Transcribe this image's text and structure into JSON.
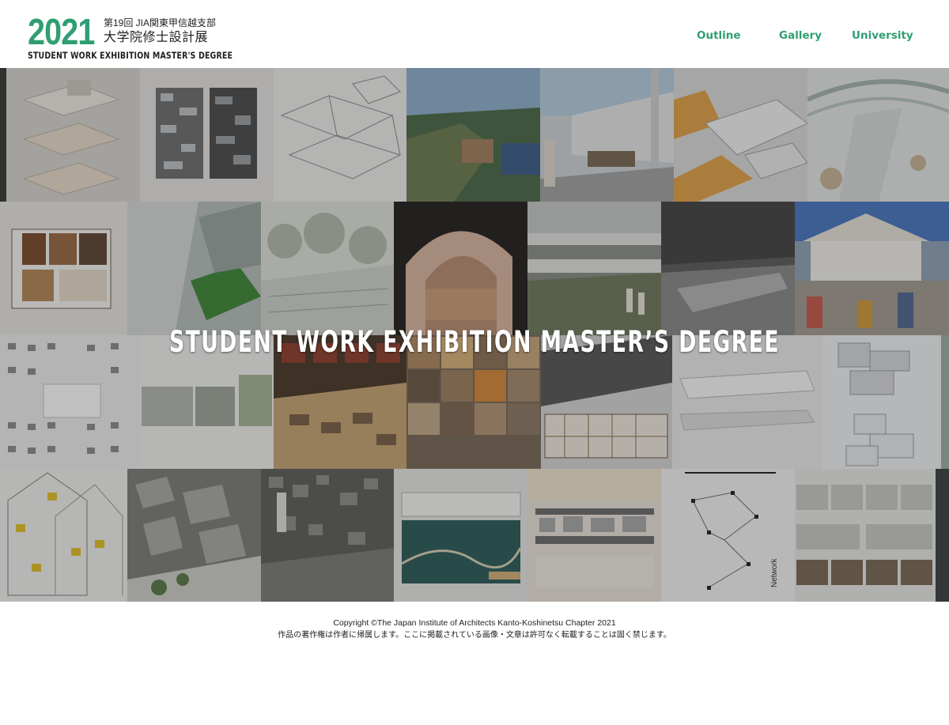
{
  "header": {
    "logo": {
      "year": "2021",
      "edition": "第19回  JIA関東甲信越支部",
      "title_jp": "大学院修士設計展",
      "title_en": "STUDENT WORK EXHIBITION MASTER'S DEGREE"
    },
    "nav": [
      {
        "label": "Outline"
      },
      {
        "label": "Gallery"
      },
      {
        "label": "University"
      }
    ]
  },
  "hero": {
    "title": "STUDENT WORK EXHIBITION MASTER’S DEGREE",
    "collage_label": "Network"
  },
  "footer": {
    "copyright": "Copyright ©The Japan Institute of Architects Kanto-Koshinetsu Chapter 2021",
    "notice": "作品の著作権は作者に帰属します。ここに掲載されている画像・文章は許可なく転載することは固く禁じます。"
  },
  "colors": {
    "accent": "#2f9e73",
    "text": "#222222",
    "overlay": "#1e1e1e"
  }
}
